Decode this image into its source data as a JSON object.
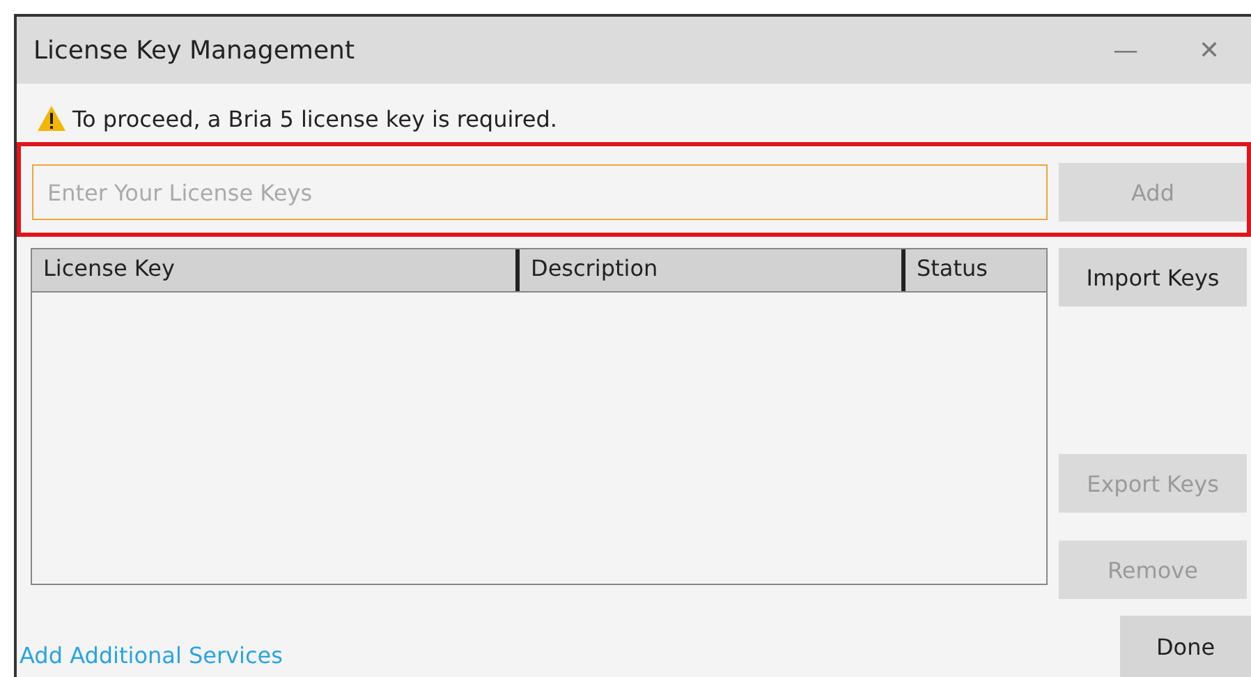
{
  "window": {
    "title": "License Key Management",
    "controls": [
      "—",
      "✕"
    ]
  },
  "warning": {
    "text": "To proceed, a Bria 5 license key is required."
  },
  "key_field": {
    "placeholder": "Enter Your License Keys"
  },
  "add_button": {
    "label": "Add",
    "disabled": true
  },
  "table": {
    "columns": [
      "License Key",
      "Description",
      "Status"
    ]
  },
  "side_buttons": [
    {
      "label": "Import Keys",
      "disabled": false
    },
    {
      "label": "Export Keys",
      "disabled": true
    },
    {
      "label": "Remove",
      "disabled": true
    }
  ],
  "link": "Add Additional Services",
  "done_button": {
    "label": "Done",
    "disabled": false
  }
}
